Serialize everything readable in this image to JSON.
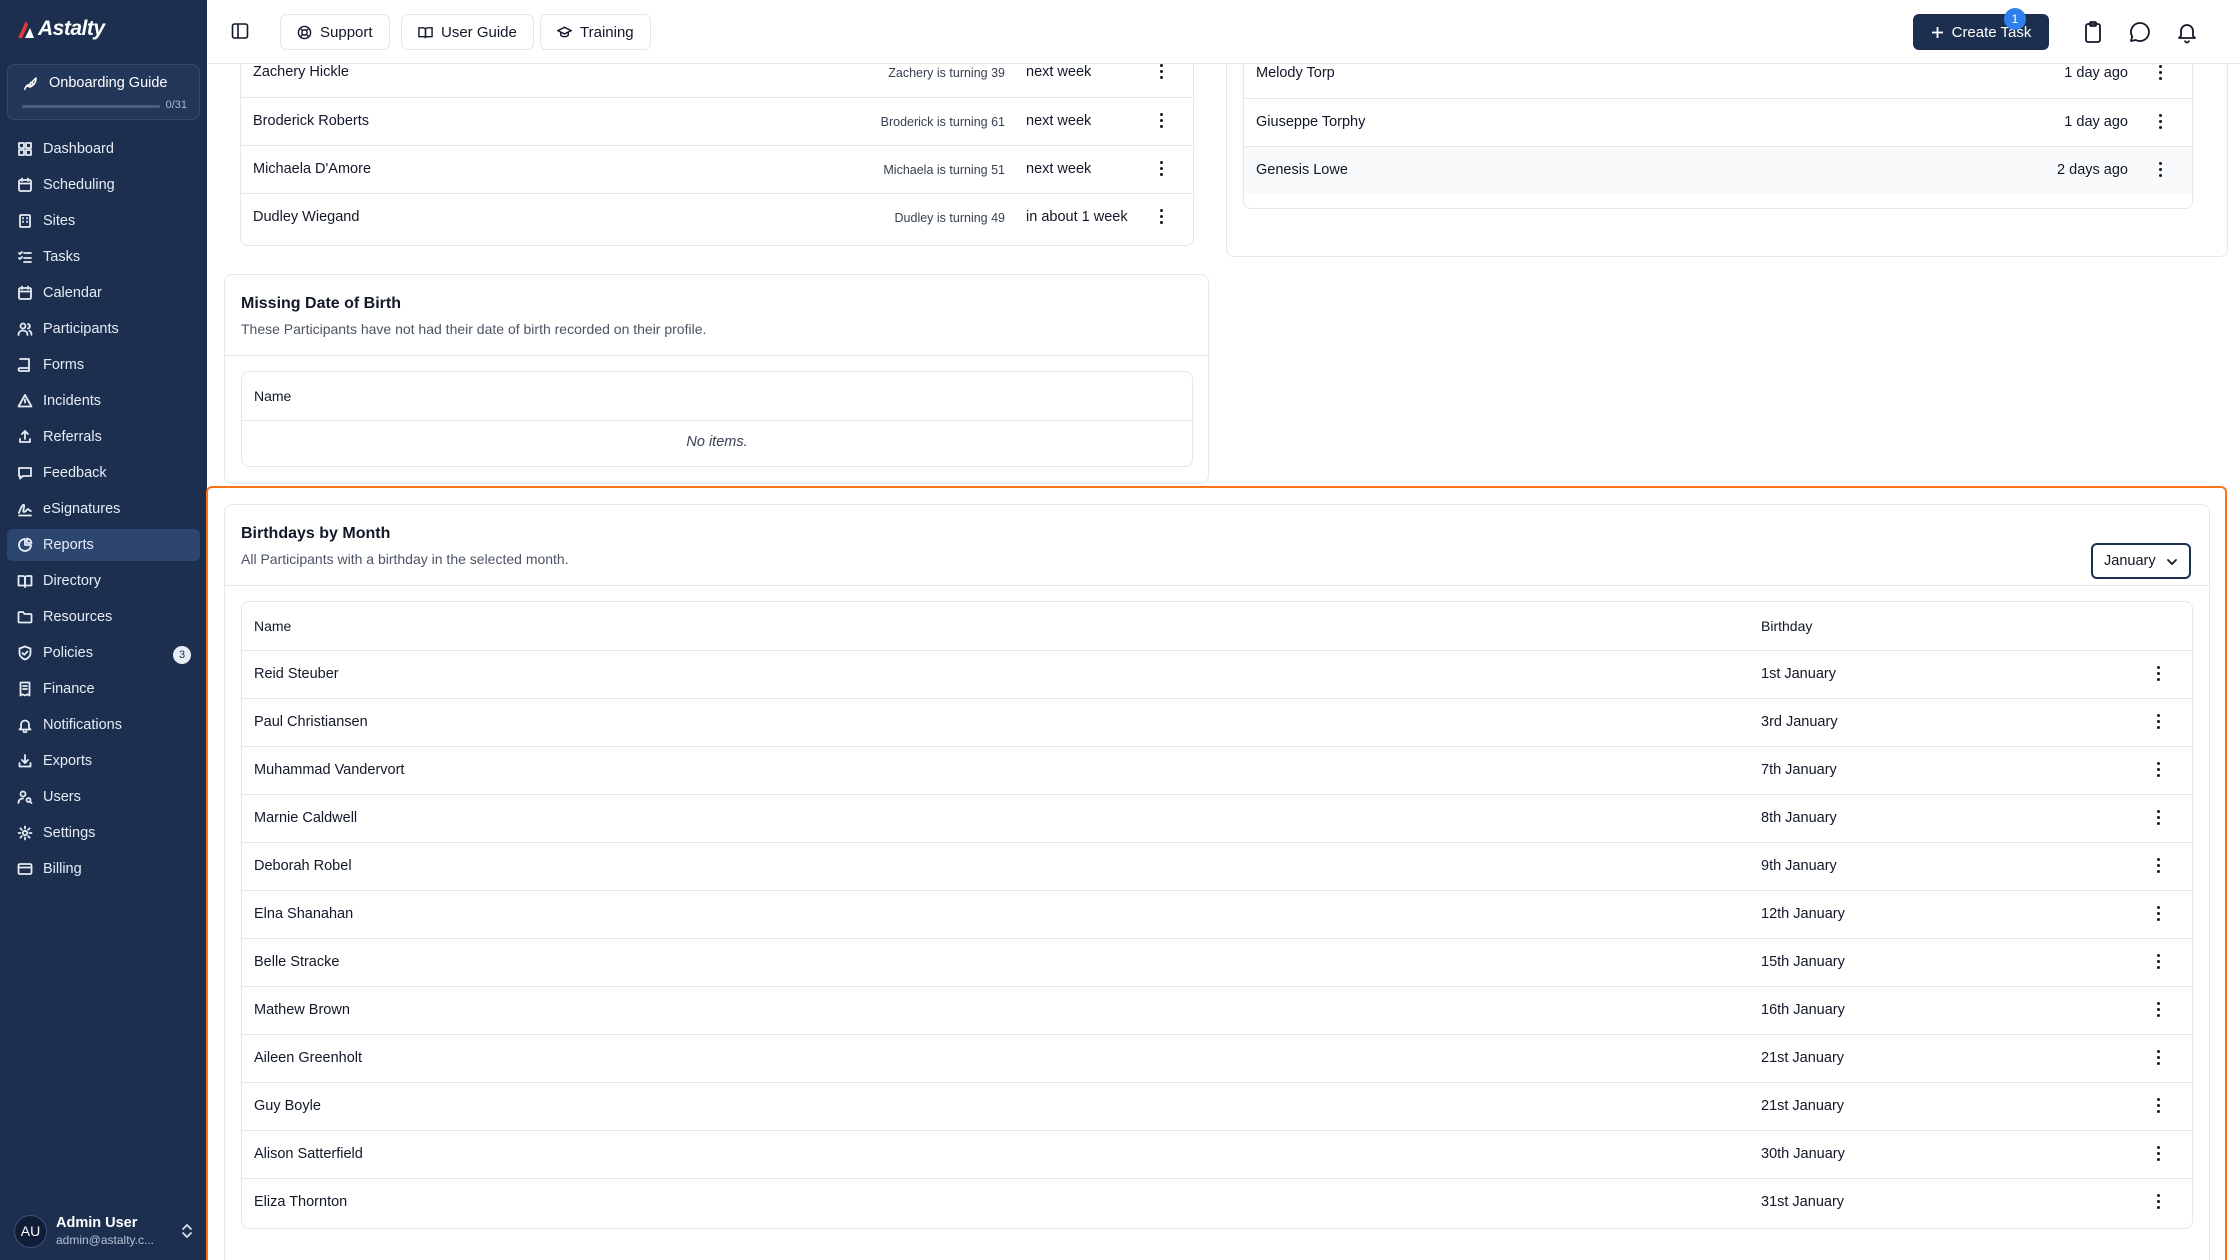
{
  "brand": {
    "name": "Astalty"
  },
  "onboarding": {
    "title": "Onboarding Guide",
    "progress_text": "0/31",
    "progress_fraction": 0.0
  },
  "nav": {
    "items": [
      {
        "label": "Dashboard",
        "icon": "dashboard-icon"
      },
      {
        "label": "Scheduling",
        "icon": "calendar-clock-icon"
      },
      {
        "label": "Sites",
        "icon": "building-icon"
      },
      {
        "label": "Tasks",
        "icon": "list-check-icon"
      },
      {
        "label": "Calendar",
        "icon": "calendar-icon"
      },
      {
        "label": "Participants",
        "icon": "users-icon"
      },
      {
        "label": "Forms",
        "icon": "book-icon"
      },
      {
        "label": "Incidents",
        "icon": "warning-triangle-icon"
      },
      {
        "label": "Referrals",
        "icon": "share-icon"
      },
      {
        "label": "Feedback",
        "icon": "message-square-icon"
      },
      {
        "label": "eSignatures",
        "icon": "signature-icon"
      },
      {
        "label": "Reports",
        "icon": "pie-chart-icon",
        "active": true
      },
      {
        "label": "Directory",
        "icon": "book-open-icon"
      },
      {
        "label": "Resources",
        "icon": "folder-icon"
      },
      {
        "label": "Policies",
        "icon": "shield-check-icon",
        "badge": "3"
      },
      {
        "label": "Finance",
        "icon": "receipt-icon"
      },
      {
        "label": "Notifications",
        "icon": "bell-ring-icon"
      },
      {
        "label": "Exports",
        "icon": "download-icon"
      },
      {
        "label": "Users",
        "icon": "user-key-icon"
      },
      {
        "label": "Settings",
        "icon": "gear-icon"
      },
      {
        "label": "Billing",
        "icon": "credit-card-icon"
      }
    ]
  },
  "user": {
    "initials": "AU",
    "name": "Admin User",
    "email": "admin@astalty.c..."
  },
  "topbar": {
    "support": "Support",
    "user_guide": "User Guide",
    "training": "Training",
    "create_task": "Create Task",
    "clipboard_badge": "1"
  },
  "upcoming_birthdays": {
    "rows": [
      {
        "name": "Zachery Hickle",
        "note": "Zachery is turning 39",
        "when": "next week"
      },
      {
        "name": "Broderick Roberts",
        "note": "Broderick is turning 61",
        "when": "next week"
      },
      {
        "name": "Michaela D'Amore",
        "note": "Michaela is turning 51",
        "when": "next week"
      },
      {
        "name": "Dudley Wiegand",
        "note": "Dudley is turning 49",
        "when": "in about 1 week"
      }
    ]
  },
  "recent_birthdays": {
    "rows": [
      {
        "name": "Melody Torp",
        "when": "1 day ago"
      },
      {
        "name": "Giuseppe Torphy",
        "when": "1 day ago"
      },
      {
        "name": "Genesis Lowe",
        "when": "2 days ago"
      }
    ]
  },
  "missing_dob": {
    "title": "Missing Date of Birth",
    "subtitle": "These Participants have not had their date of birth recorded on their profile.",
    "col_name": "Name",
    "empty": "No items."
  },
  "birthdays_by_month": {
    "title": "Birthdays by Month",
    "subtitle": "All Participants with a birthday in the selected month.",
    "selected_month": "January",
    "col_name": "Name",
    "col_birthday": "Birthday",
    "rows": [
      {
        "name": "Reid Steuber",
        "birthday": "1st January"
      },
      {
        "name": "Paul Christiansen",
        "birthday": "3rd January"
      },
      {
        "name": "Muhammad Vandervort",
        "birthday": "7th January"
      },
      {
        "name": "Marnie Caldwell",
        "birthday": "8th January"
      },
      {
        "name": "Deborah Robel",
        "birthday": "9th January"
      },
      {
        "name": "Elna Shanahan",
        "birthday": "12th January"
      },
      {
        "name": "Belle Stracke",
        "birthday": "15th January"
      },
      {
        "name": "Mathew Brown",
        "birthday": "16th January"
      },
      {
        "name": "Aileen Greenholt",
        "birthday": "21st January"
      },
      {
        "name": "Guy Boyle",
        "birthday": "21st January"
      },
      {
        "name": "Alison Satterfield",
        "birthday": "30th January"
      },
      {
        "name": "Eliza Thornton",
        "birthday": "31st January"
      }
    ]
  }
}
